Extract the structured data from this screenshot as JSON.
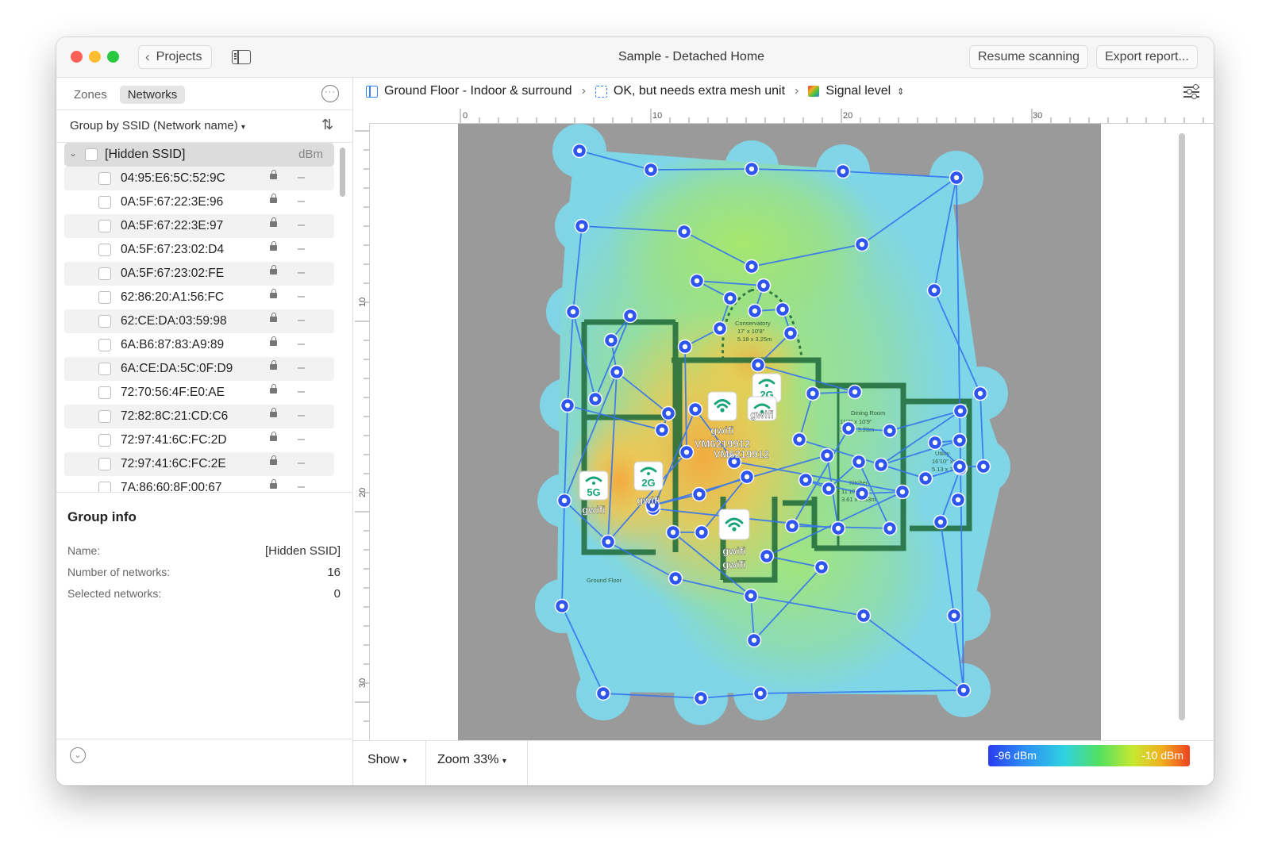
{
  "window": {
    "title": "Sample - Detached Home"
  },
  "toolbar": {
    "back_label": "Projects",
    "resume_label": "Resume scanning",
    "export_label": "Export report..."
  },
  "sidebar": {
    "tabs": [
      {
        "label": "Zones",
        "active": false
      },
      {
        "label": "Networks",
        "active": true
      }
    ],
    "group_by_label": "Group by SSID (Network name)",
    "group": {
      "name": "[Hidden SSID]",
      "unit": "dBm"
    },
    "networks": [
      {
        "bssid": "04:95:E6:5C:52:9C",
        "value": "–"
      },
      {
        "bssid": "0A:5F:67:22:3E:96",
        "value": "–"
      },
      {
        "bssid": "0A:5F:67:22:3E:97",
        "value": "–"
      },
      {
        "bssid": "0A:5F:67:23:02:D4",
        "value": "–"
      },
      {
        "bssid": "0A:5F:67:23:02:FE",
        "value": "–"
      },
      {
        "bssid": "62:86:20:A1:56:FC",
        "value": "–"
      },
      {
        "bssid": "62:CE:DA:03:59:98",
        "value": "–"
      },
      {
        "bssid": "6A:B6:87:83:A9:89",
        "value": "–"
      },
      {
        "bssid": "6A:CE:DA:5C:0F:D9",
        "value": "–"
      },
      {
        "bssid": "72:70:56:4F:E0:AE",
        "value": "–"
      },
      {
        "bssid": "72:82:8C:21:CD:C6",
        "value": "–"
      },
      {
        "bssid": "72:97:41:6C:FC:2D",
        "value": "–"
      },
      {
        "bssid": "72:97:41:6C:FC:2E",
        "value": "–"
      },
      {
        "bssid": "7A:86:60:8F:00:67",
        "value": "–"
      }
    ]
  },
  "group_info": {
    "title": "Group info",
    "name_label": "Name:",
    "name_value": "[Hidden SSID]",
    "count_label": "Number of networks:",
    "count_value": "16",
    "selected_label": "Selected networks:",
    "selected_value": "0"
  },
  "breadcrumb": {
    "floor": "Ground Floor - Indoor & surround",
    "zone": "OK, but needs extra mesh unit",
    "view": "Signal level"
  },
  "rulers": {
    "h_labels": [
      "0",
      "10",
      "20",
      "30"
    ],
    "v_labels": [
      "10",
      "20",
      "30"
    ]
  },
  "map": {
    "plan_labels": [
      "Conservatory",
      "17' x 10'8\"",
      "5.18 x 3.25m",
      "Dining Room",
      "11'3\" x 10'9\"",
      "3.38 x 3.28m",
      "Kitchen",
      "11'10\" x 11'",
      "3.61 x 3.33m",
      "Utility",
      "16'10\" x 8'8\"",
      "5.13 x 2.64m",
      "Ground Floor"
    ],
    "access_points": [
      {
        "band": "",
        "names": [
          "gwifi",
          "VM6219912"
        ]
      },
      {
        "band": "2G",
        "names": [
          "gwifi",
          "VM6219912"
        ]
      },
      {
        "band": "5G",
        "names": [
          "gwifi"
        ]
      },
      {
        "band": "2G",
        "names": [
          "gwifi"
        ]
      },
      {
        "band": "",
        "names": [
          "gwifi",
          "gwifi"
        ]
      }
    ],
    "heatmap_colors": {
      "cold": "#6fd0e8",
      "mid": "#9ee27a",
      "warm": "#f5c64e",
      "hot": "#f7a83a",
      "point": "#2f55f0"
    }
  },
  "footer": {
    "show_label": "Show",
    "zoom_label": "Zoom 33%",
    "legend_min": "-96 dBm",
    "legend_max": "-10 dBm"
  }
}
